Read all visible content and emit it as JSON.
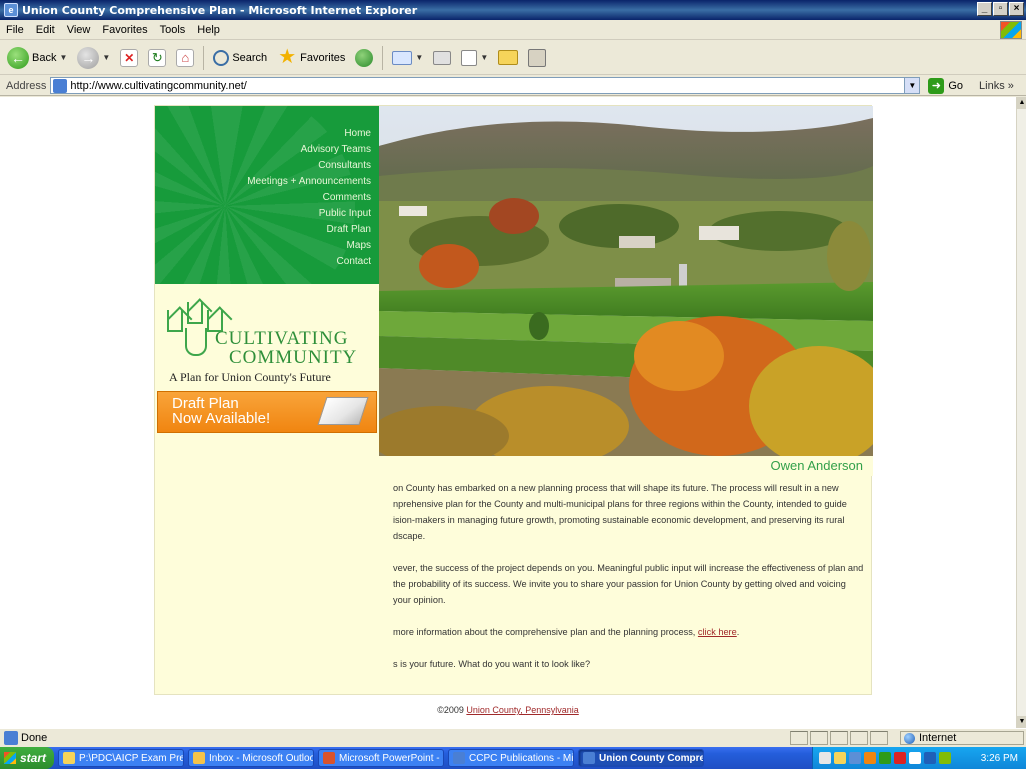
{
  "window": {
    "title": "Union County Comprehensive Plan - Microsoft Internet Explorer",
    "controls": [
      "_",
      "×"
    ]
  },
  "menubar": {
    "items": [
      "File",
      "Edit",
      "View",
      "Favorites",
      "Tools",
      "Help"
    ]
  },
  "toolbar": {
    "back_label": "Back",
    "search_label": "Search",
    "favorites_label": "Favorites"
  },
  "addressbar": {
    "label": "Address",
    "url": "http://www.cultivatingcommunity.net/",
    "go_label": "Go",
    "links_label": "Links »"
  },
  "site": {
    "nav": [
      "Home",
      "Advisory Teams",
      "Consultants",
      "Meetings + Announcements",
      "Comments",
      "Public Input",
      "Draft Plan",
      "Maps",
      "Contact"
    ],
    "logo": {
      "line1": "CULTIVATING",
      "line2": "COMMUNITY",
      "tagline": "A Plan for Union County's Future"
    },
    "banner": {
      "line1": "Draft Plan",
      "line2": "Now Available!"
    },
    "photo_caption": "Owen Anderson",
    "paragraphs": [
      "on County has embarked on a new planning process that will shape its future. The process will result in a new nprehensive plan for the County and multi-municipal plans for three regions within the County, intended to guide ision-makers in managing future growth, promoting sustainable economic development, and preserving its rural dscape.",
      "vever, the success of the project depends on you. Meaningful public input will increase the effectiveness of plan and the probability of its success. We invite you to share your passion for Union County by getting olved and voicing your opinion."
    ],
    "more_info": {
      "prefix": "more information about the comprehensive plan and the planning process,",
      "link": "click here",
      "suffix": "."
    },
    "closing": "s is your future. What do you want it to look like?",
    "footer": {
      "copyright": "©2009",
      "link": "Union County, Pennsylvania"
    }
  },
  "statusbar": {
    "status": "Done",
    "zone": "Internet"
  },
  "taskbar": {
    "start_label": "start",
    "tasks": [
      "P:\\PDC\\AICP Exam Prep\\...",
      "Inbox - Microsoft Outlook",
      "Microsoft PowerPoint - [...",
      "CCPC Publications - Micr...",
      "Union County Compre..."
    ],
    "clock": "3:26 PM"
  },
  "colors": {
    "nav_green": "#179b3b",
    "page_cream": "#fefdda",
    "logo_green": "#2f8f3a",
    "banner_orange": "#f08510",
    "link_red": "#a0292a"
  }
}
